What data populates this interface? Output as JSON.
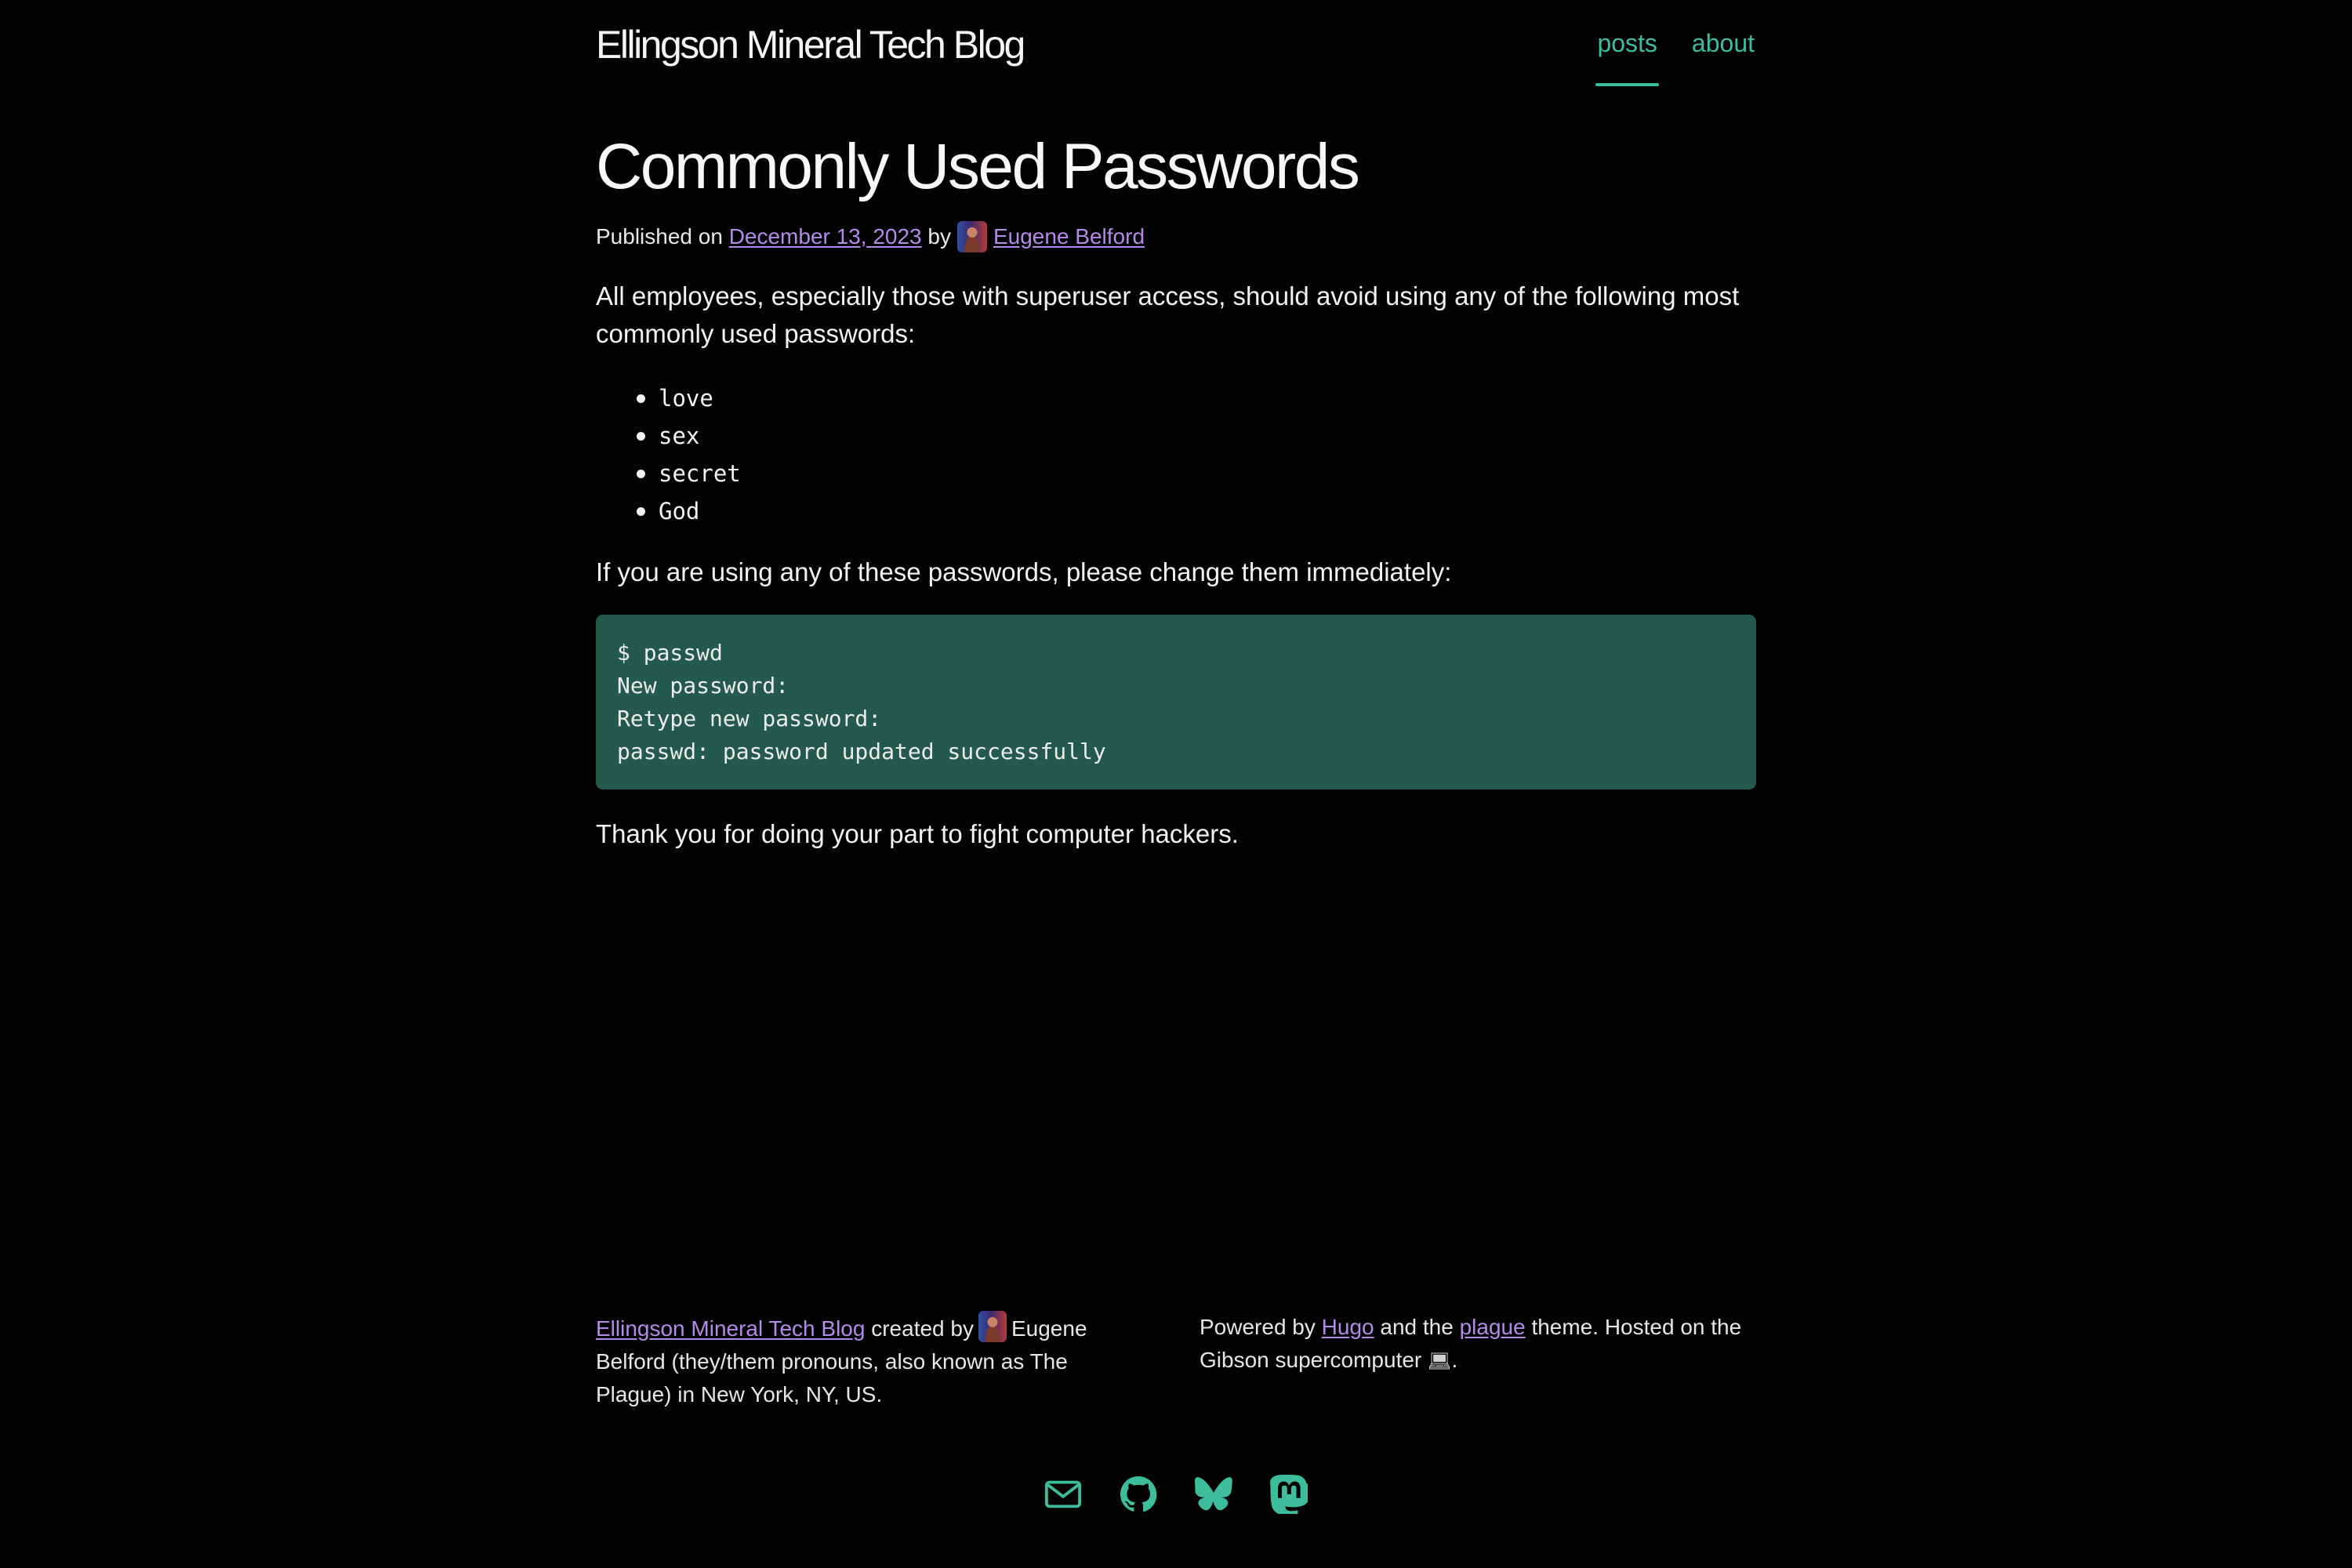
{
  "header": {
    "site_title": "Ellingson Mineral Tech Blog",
    "nav": [
      {
        "label": "posts",
        "active": true
      },
      {
        "label": "about",
        "active": false
      }
    ]
  },
  "post": {
    "title": "Commonly Used Passwords",
    "byline": {
      "published_prefix": "Published on",
      "date": "December 13, 2023",
      "by": "by",
      "author": "Eugene Belford"
    },
    "intro": "All employees, especially those with superuser access, should avoid using any of the following most commonly used passwords:",
    "passwords": [
      "love",
      "sex",
      "secret",
      "God"
    ],
    "change_text": "If you are using any of these passwords, please change them immediately:",
    "code_lines": [
      "$ passwd",
      "New password:",
      "Retype new password:",
      "passwd: password updated successfully"
    ],
    "thanks": "Thank you for doing your part to fight computer hackers."
  },
  "footer": {
    "left": {
      "blog_link": "Ellingson Mineral Tech Blog",
      "created_by": "created by",
      "author_text": "Eugene Belford (they/them pronouns, also known as The Plague) in New York, NY, US."
    },
    "right": {
      "powered_by": "Powered by",
      "hugo_link": "Hugo",
      "and_the": "and the",
      "theme_link": "plague",
      "theme_hosted": "theme. Hosted on the Gibson supercomputer",
      "period": "."
    },
    "social_icons": [
      "email-icon",
      "github-icon",
      "bluesky-icon",
      "mastodon-icon"
    ]
  },
  "colors": {
    "background": "#030303",
    "accent_teal": "#3dbd9c",
    "link_purple": "#b48ae8",
    "code_background": "#245a4c"
  }
}
